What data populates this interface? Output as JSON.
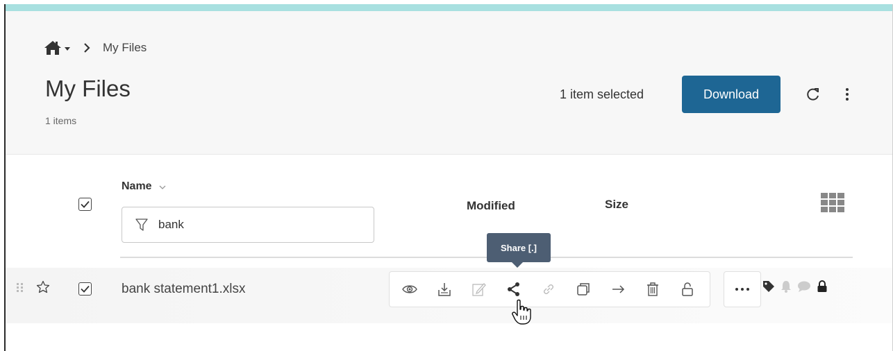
{
  "breadcrumb": {
    "home_icon": "home-icon",
    "current": "My Files"
  },
  "header": {
    "title": "My Files",
    "item_count": "1 items",
    "selection_text": "1 item selected",
    "download_label": "Download"
  },
  "columns": {
    "name": "Name",
    "modified": "Modified",
    "size": "Size"
  },
  "filter": {
    "value": "bank"
  },
  "rows": [
    {
      "name": "bank statement1.xlsx",
      "checked": true,
      "starred": false
    }
  ],
  "actions": [
    "view",
    "download",
    "edit",
    "share",
    "link",
    "copy",
    "move",
    "delete",
    "lock"
  ],
  "tooltip": {
    "text": "Share [.]"
  },
  "colors": {
    "accent": "#1e6694",
    "top_bar": "#a8e0e0",
    "tooltip_bg": "#4d5e73"
  }
}
